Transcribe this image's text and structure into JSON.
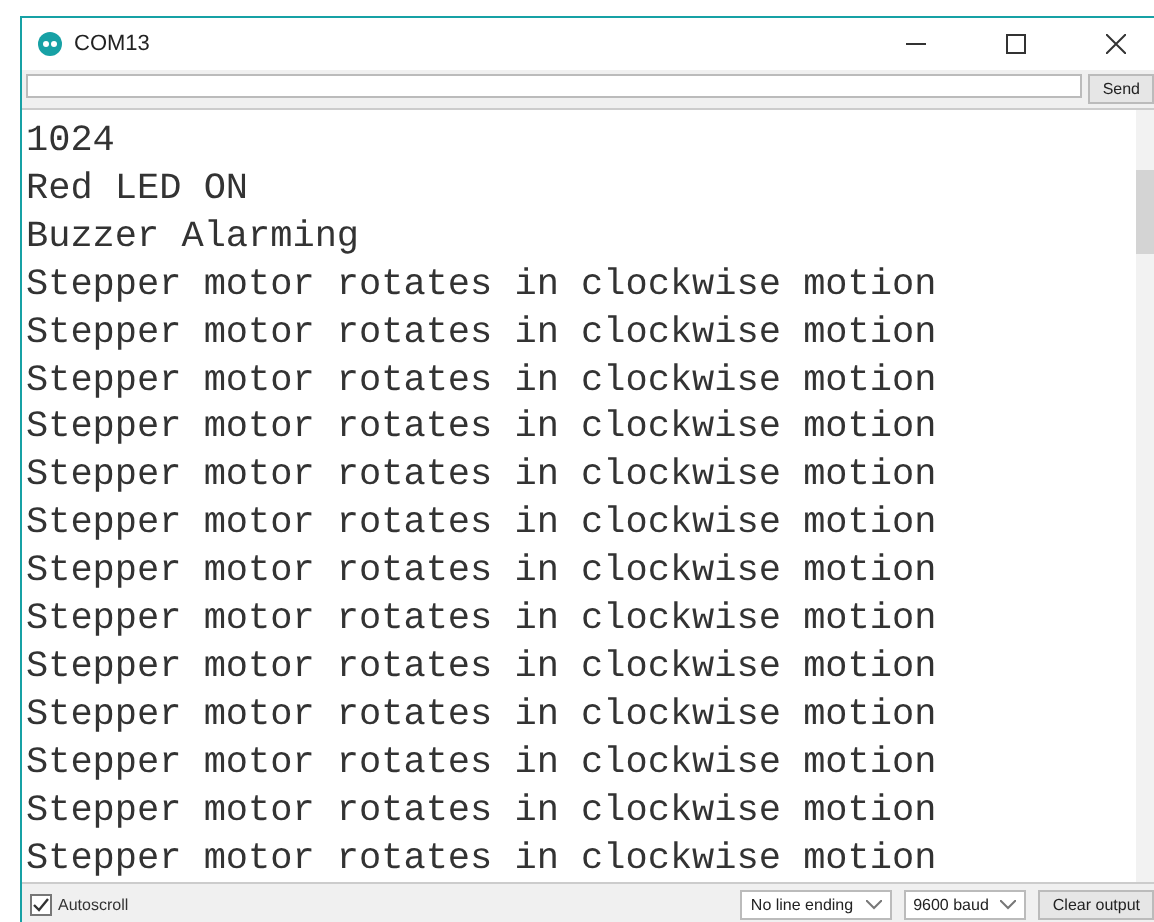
{
  "window": {
    "title": "COM13"
  },
  "input": {
    "button": "Send"
  },
  "output": [
    "1024",
    "Red LED ON",
    "Buzzer Alarming",
    "Stepper motor rotates in clockwise motion",
    "Stepper motor rotates in clockwise motion",
    "Stepper motor rotates in clockwise motion",
    "Stepper motor rotates in clockwise motion",
    "Stepper motor rotates in clockwise motion",
    "Stepper motor rotates in clockwise motion",
    "Stepper motor rotates in clockwise motion",
    "Stepper motor rotates in clockwise motion",
    "Stepper motor rotates in clockwise motion",
    "Stepper motor rotates in clockwise motion",
    "Stepper motor rotates in clockwise motion",
    "Stepper motor rotates in clockwise motion",
    "Stepper motor rotates in clockwise motion"
  ],
  "footer": {
    "autoscroll": {
      "label": "Autoscroll",
      "checked": true
    },
    "line_ending": "No line ending",
    "baud": "9600 baud",
    "clear": "Clear output"
  }
}
